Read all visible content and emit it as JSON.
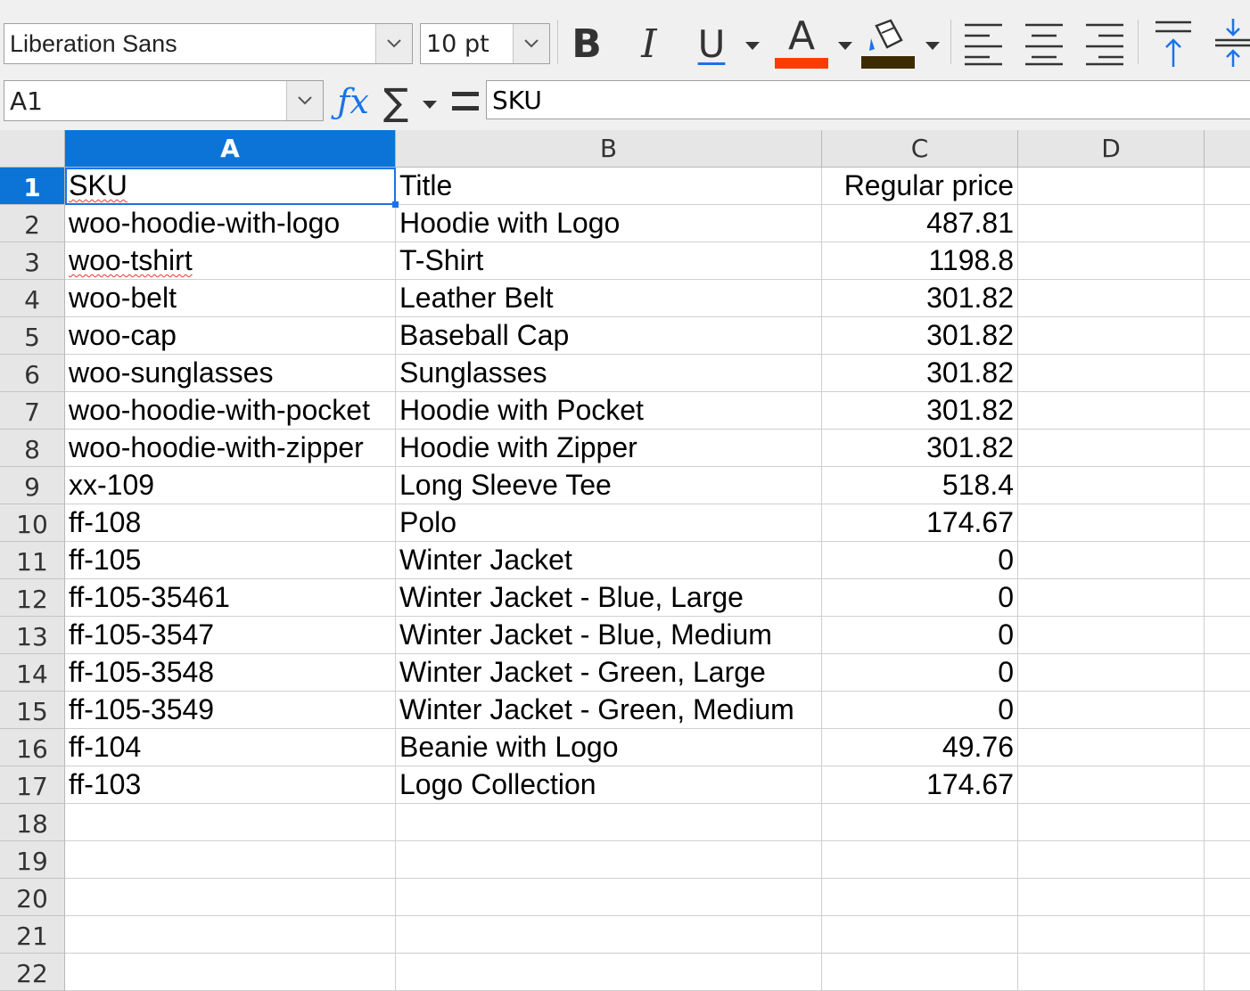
{
  "toolbar": {
    "font_name": "Liberation Sans",
    "font_size": "10 pt",
    "bold_label": "B",
    "italic_label": "I",
    "underline_label": "U",
    "font_color_label": "A",
    "font_color": "#ff3b00",
    "highlight_color": "#3d2c00",
    "icons": [
      "bold-icon",
      "italic-icon",
      "underline-icon",
      "font-color-icon",
      "highlight-icon",
      "align-left-icon",
      "align-center-icon",
      "align-right-icon",
      "align-top-icon",
      "align-middle-icon"
    ]
  },
  "formula_bar": {
    "name_box": "A1",
    "content": "SKU",
    "icons": [
      "function-wizard-icon",
      "sum-icon",
      "formula-icon"
    ]
  },
  "sheet": {
    "columns": [
      "A",
      "B",
      "C",
      "D"
    ],
    "active_column": "A",
    "active_row": "1",
    "row_numbers": [
      "1",
      "2",
      "3",
      "4",
      "5",
      "6",
      "7",
      "8",
      "9",
      "10",
      "11",
      "12",
      "13",
      "14",
      "15",
      "16",
      "17",
      "18",
      "19",
      "20",
      "21",
      "22"
    ],
    "rows": [
      {
        "a": "SKU",
        "b": "Title",
        "c": "Regular price"
      },
      {
        "a": "woo-hoodie-with-logo",
        "b": "Hoodie with Logo",
        "c": "487.81"
      },
      {
        "a": "woo-tshirt",
        "b": "T-Shirt",
        "c": "1198.8"
      },
      {
        "a": "woo-belt",
        "b": "Leather Belt",
        "c": "301.82"
      },
      {
        "a": "woo-cap",
        "b": "Baseball Cap",
        "c": "301.82"
      },
      {
        "a": "woo-sunglasses",
        "b": "Sunglasses",
        "c": "301.82"
      },
      {
        "a": "woo-hoodie-with-pocket",
        "b": "Hoodie with Pocket",
        "c": "301.82"
      },
      {
        "a": "woo-hoodie-with-zipper",
        "b": "Hoodie with Zipper",
        "c": "301.82"
      },
      {
        "a": "xx-109",
        "b": "Long Sleeve Tee",
        "c": "518.4"
      },
      {
        "a": "ff-108",
        "b": "Polo",
        "c": "174.67"
      },
      {
        "a": "ff-105",
        "b": "Winter Jacket",
        "c": "0"
      },
      {
        "a": "ff-105-35461",
        "b": "Winter Jacket - Blue, Large",
        "c": "0"
      },
      {
        "a": "ff-105-3547",
        "b": "Winter Jacket - Blue, Medium",
        "c": "0"
      },
      {
        "a": "ff-105-3548",
        "b": "Winter Jacket - Green, Large",
        "c": "0"
      },
      {
        "a": "ff-105-3549",
        "b": "Winter Jacket - Green, Medium",
        "c": "0"
      },
      {
        "a": "ff-104",
        "b": "Beanie with Logo",
        "c": "49.76"
      },
      {
        "a": "ff-103",
        "b": "Logo Collection",
        "c": "174.67"
      }
    ]
  }
}
